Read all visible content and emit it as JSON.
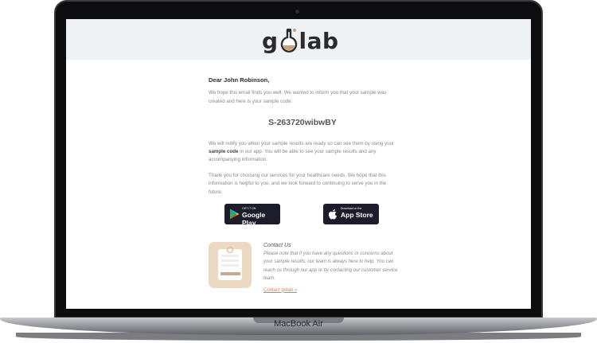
{
  "device": {
    "label": "MacBook Air"
  },
  "email": {
    "logo": {
      "left": "g",
      "right": "lab"
    },
    "greeting": "Dear John Robinson,",
    "intro": "We hope this email finds you well. We wanted to inform you that your sample was created and here is your sample code:",
    "sample_code": "S-263720wibwBY",
    "notify_before": "We will notify you when your sample results are ready so can see them by using your ",
    "notify_strong": "sample code",
    "notify_after": " in our app. You will be able to see your sample results and any accompanying information.",
    "thanks": "Thank you for choosing our services for your healthcare needs. We hope that this information is helpful to you, and we look forward to continuing to serve you in the future.",
    "stores": {
      "google": {
        "small": "GET IT ON",
        "big": "Google Play"
      },
      "apple": {
        "small": "Download on the",
        "big": "App Store"
      }
    },
    "contact": {
      "title": "Contact Us",
      "body": "Please note that if you have any questions or concerns about your sample results, our team is always here to help. You can reach us through our app or by contacting our customer service team.",
      "link": "Contact golab »"
    }
  },
  "colors": {
    "accent": "#c9825d",
    "header_bg": "#eff2f4",
    "store_button": "#1c1c2b",
    "contact_icon_bg": "#ecd9c4"
  }
}
